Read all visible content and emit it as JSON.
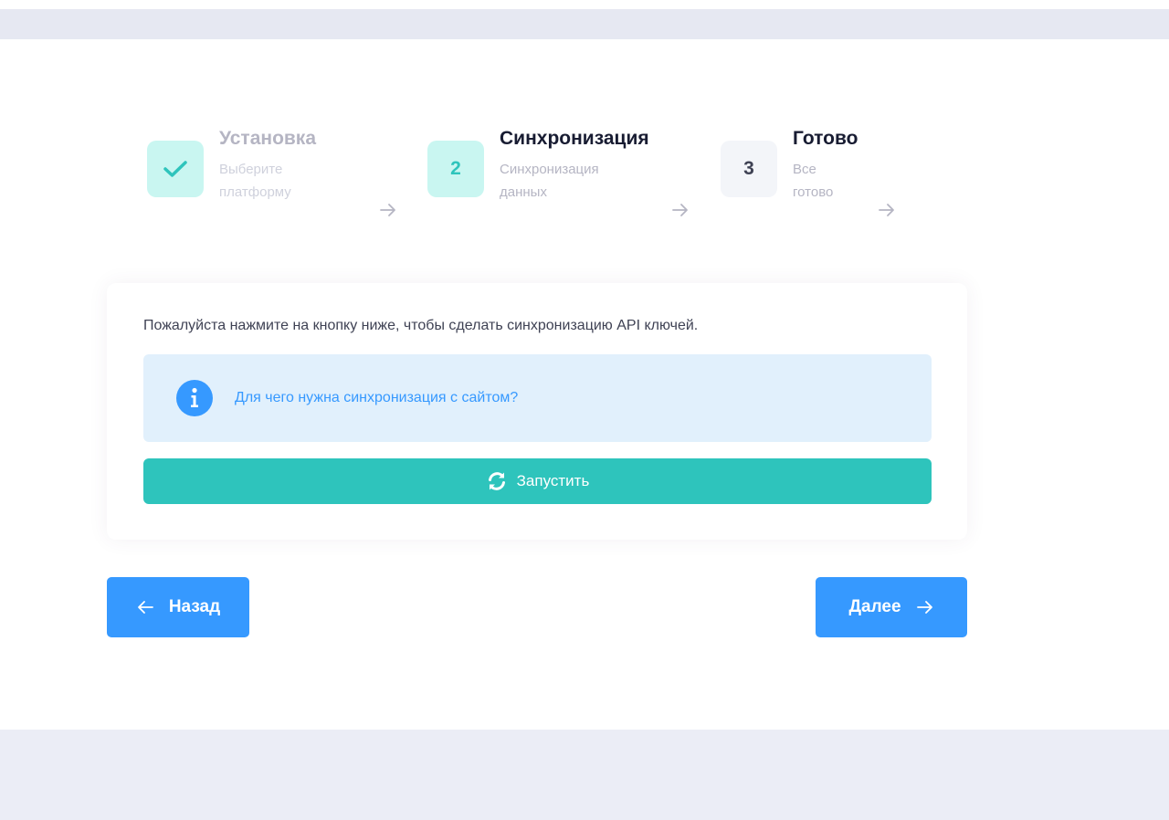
{
  "stepper": {
    "steps": [
      {
        "title": "Установка",
        "desc_line1": "Выберите",
        "desc_line2": "платформу",
        "status": "done"
      },
      {
        "number": "2",
        "title": "Синхронизация",
        "desc_line1": "Синхронизация",
        "desc_line2": "данных",
        "status": "current"
      },
      {
        "number": "3",
        "title": "Готово",
        "desc_line1": "Все",
        "desc_line2": "готово",
        "status": "pending"
      }
    ]
  },
  "card": {
    "instruction": "Пожалуйста нажмите на кнопку ниже, чтобы сделать синхронизацию API ключей.",
    "info_link": "Для чего нужна синхронизация с сайтом?",
    "run_label": "Запустить"
  },
  "nav": {
    "back_label": "Назад",
    "next_label": "Далее"
  },
  "colors": {
    "accent_teal": "#2ec4bc",
    "primary_blue": "#3699ff",
    "info_bg": "#e1f0fc",
    "step_done_bg": "#c9f6f1"
  },
  "icons": {
    "step_done": "check-icon",
    "step_arrow": "arrow-right-icon",
    "info": "info-circle-icon",
    "run": "sync-icon",
    "back": "arrow-left-icon",
    "next": "arrow-right-icon"
  }
}
